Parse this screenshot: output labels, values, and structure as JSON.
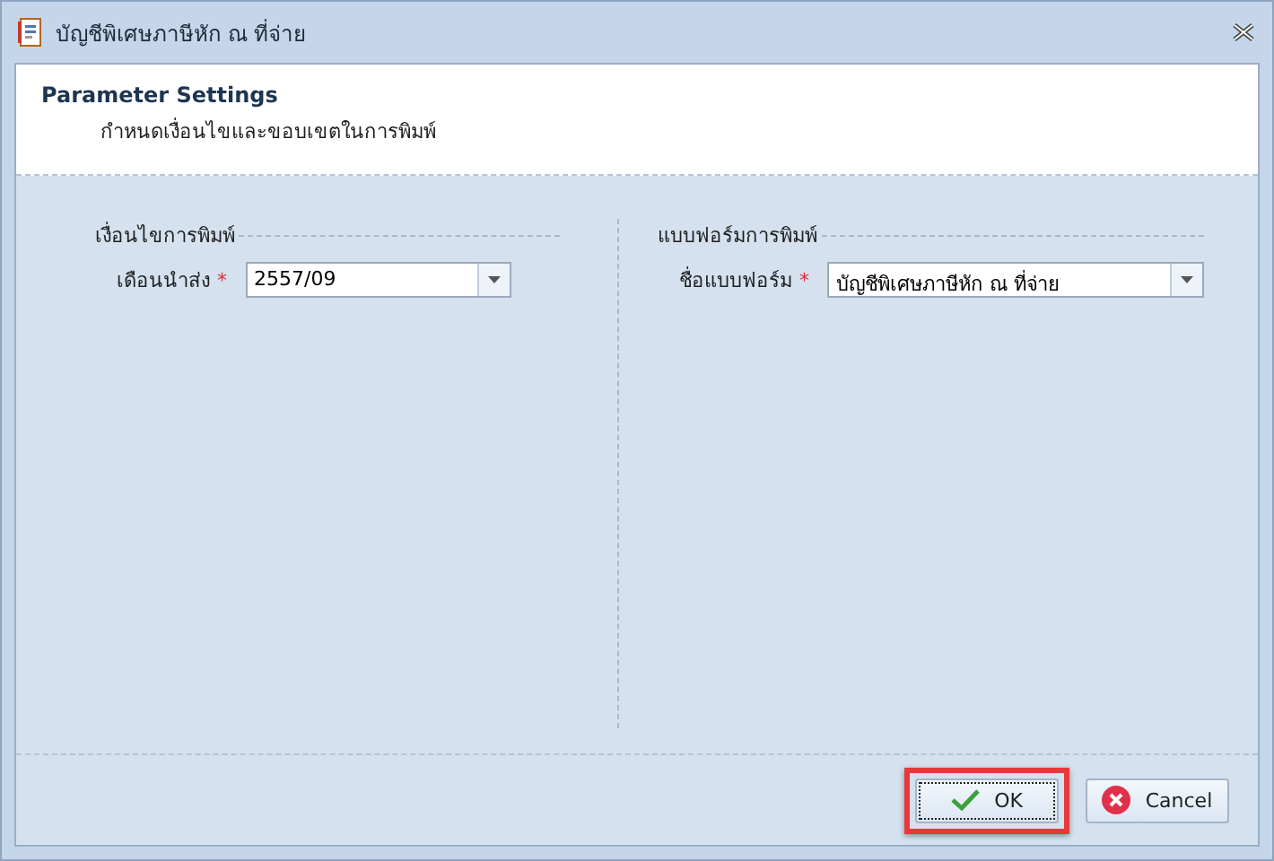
{
  "window": {
    "title": "บัญชีพิเศษภาษีหัก ณ ที่จ่าย"
  },
  "header": {
    "title": "Parameter Settings",
    "subtitle": "กำหนดเงื่อนไขและขอบเขตในการพิมพ์"
  },
  "groups": [
    {
      "title": "เงื่อนไขการพิมพ์",
      "fields": [
        {
          "label": "เดือนนำส่ง",
          "required_mark": "*",
          "value": "2557/09"
        }
      ]
    },
    {
      "title": "แบบฟอร์มการพิมพ์",
      "fields": [
        {
          "label": "ชื่อแบบฟอร์ม",
          "required_mark": "*",
          "value": "บัญชีพิเศษภาษีหัก ณ ที่จ่าย"
        }
      ]
    }
  ],
  "buttons": [
    {
      "label": "OK",
      "kind": "ok",
      "highlighted": true
    },
    {
      "label": "Cancel",
      "kind": "cancel",
      "highlighted": false
    }
  ]
}
